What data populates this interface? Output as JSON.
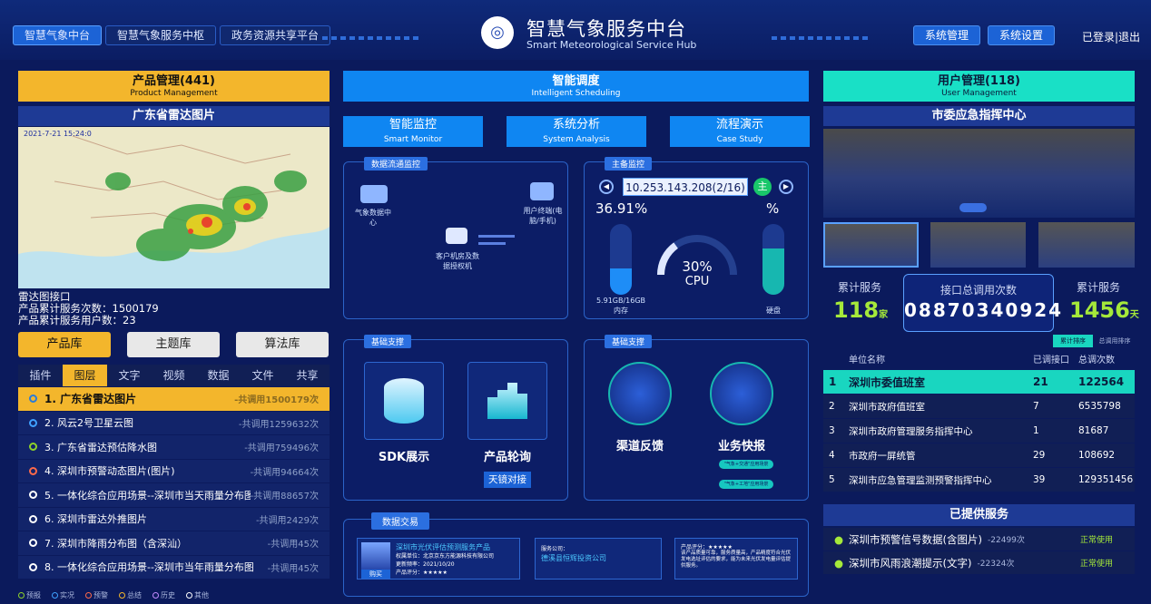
{
  "header": {
    "tabs": [
      "智慧气象中台",
      "智慧气象服务中枢",
      "政务资源共享平台"
    ],
    "title_cn": "智慧气象服务中台",
    "title_en": "Smart Meteorological Service Hub",
    "right_buttons": [
      "系统管理",
      "系统设置"
    ],
    "login": "已登录|退出"
  },
  "left": {
    "title": "产品管理(441)",
    "title_en": "Product Management",
    "sub_title": "广东省雷达图片",
    "map_time": "2021-7-21 15:24:0",
    "info": [
      "雷达图接口",
      "产品累计服务次数：1500179",
      "产品累计服务用户数：23"
    ],
    "library_buttons": [
      "产品库",
      "主题库",
      "算法库"
    ],
    "tabs": [
      "插件",
      "图层",
      "文字",
      "视频",
      "数据",
      "文件",
      "共享"
    ],
    "items": [
      {
        "label": "1. 广东省雷达图片",
        "count": "-共调用1500179次",
        "color": "#2a7bd8"
      },
      {
        "label": "2. 风云2号卫星云图",
        "count": "-共调用1259632次",
        "color": "#3fa1ff"
      },
      {
        "label": "3. 广东省雷达预估降水图",
        "count": "-共调用759496次",
        "color": "#8fd32a"
      },
      {
        "label": "4. 深圳市预警动态图片(图片)",
        "count": "-共调用94664次",
        "color": "#ff6a4a"
      },
      {
        "label": "5. 一体化综合应用场景--深圳市当天雨量分布图",
        "count": "-共调用88657次",
        "color": "#ffffff"
      },
      {
        "label": "6. 深圳市雷达外推图片",
        "count": "-共调用2429次",
        "color": "#ffffff"
      },
      {
        "label": "7. 深圳市降雨分布图（含深汕）",
        "count": "-共调用45次",
        "color": "#ffffff"
      },
      {
        "label": "8. 一体化综合应用场景--深圳市当年雨量分布图",
        "count": "-共调用45次",
        "color": "#ffffff"
      }
    ],
    "legend": [
      {
        "label": "预报",
        "color": "#8fd32a"
      },
      {
        "label": "实况",
        "color": "#3fa1ff"
      },
      {
        "label": "预警",
        "color": "#ff6a4a"
      },
      {
        "label": "总结",
        "color": "#f3b62c"
      },
      {
        "label": "历史",
        "color": "#c28bff"
      },
      {
        "label": "其他",
        "color": "#ffffff"
      }
    ]
  },
  "middle": {
    "title": "智能调度",
    "title_en": "Intelligent Scheduling",
    "buttons": [
      {
        "cn": "智能监控",
        "en": "Smart Monitor"
      },
      {
        "cn": "系统分析",
        "en": "System Analysis"
      },
      {
        "cn": "流程演示",
        "en": "Case Study"
      }
    ],
    "flow": {
      "tag": "数据流通监控",
      "node1": "气象数据中心",
      "node2": "客户机房及数据授权机",
      "node3": "用户终端(电脑/手机)"
    },
    "host": {
      "tag": "主备监控",
      "ip": "10.253.143.208(2/16)",
      "badge": "主",
      "mem_pct": "36.91%",
      "mem_label": "5.91GB/16GB",
      "mem_sub": "内存",
      "cpu_pct": "30%",
      "cpu_label": "CPU",
      "disk_pct": "%",
      "disk_sub": "硬盘",
      "mem_fill": 0.3691,
      "cpu_fill": 0.3,
      "disk_fill": 0.65
    },
    "support_left": {
      "tag": "基础支撑",
      "sdk": "SDK展示",
      "product": "产品轮询",
      "btn": "天镜对接"
    },
    "support_right": {
      "tag": "基础支撑",
      "feedback": "渠道反馈",
      "report": "业务快报",
      "chip1": "\"气象+交通\"应用场景",
      "chip2": "\"气象+工地\"应用场景"
    },
    "trade": {
      "tag": "数据交易",
      "product_title": "深圳市光伏评估预测服务产品",
      "product_unit": "权属单位：北京京东方能源科技有限公司",
      "product_freq": "更新频率：2021/10/20",
      "product_score": "产品评分：★★★★★",
      "buy_label": "购买",
      "company_label": "服务公司：",
      "company_name": "德溪县恒辉投资公司",
      "review_label": "产品评分：★★★★★",
      "review_text": "该产品质量可靠，服务质量高，产品精度符合光伏发电选址评估的要求，能为未来光伏发电量评估提供服务。"
    }
  },
  "right": {
    "title": "用户管理(118)",
    "title_en": "User Management",
    "sub_title": "市委应急指挥中心",
    "stat1_label": "累计服务",
    "stat1_value": "118",
    "stat1_unit": "家",
    "stat2_label": "接口总调用次数",
    "stat2_value": "08870340924",
    "stat3_label": "累计服务",
    "stat3_value": "1456",
    "stat3_unit": "天",
    "sort_tabs": [
      "累计排序",
      "总调用排序"
    ],
    "table_headers": [
      "单位名称",
      "已调接口",
      "总调次数"
    ],
    "table_rows": [
      {
        "n": "1",
        "unit": "深圳市委值班室",
        "a": "21",
        "b": "122564"
      },
      {
        "n": "2",
        "unit": "深圳市政府值班室",
        "a": "7",
        "b": "6535798"
      },
      {
        "n": "3",
        "unit": "深圳市政府管理服务指挥中心",
        "a": "1",
        "b": "81687"
      },
      {
        "n": "4",
        "unit": "市政府一屏统管",
        "a": "29",
        "b": "108692"
      },
      {
        "n": "5",
        "unit": "深圳市应急管理监测预警指挥中心",
        "a": "39",
        "b": "129351456"
      }
    ],
    "services_title": "已提供服务",
    "services": [
      {
        "label": "深圳市预警信号数据(含图片)",
        "count": "-22499次",
        "status": "正常使用"
      },
      {
        "label": "深圳市风雨浪潮提示(文字)",
        "count": "-22324次",
        "status": "正常使用"
      }
    ]
  }
}
